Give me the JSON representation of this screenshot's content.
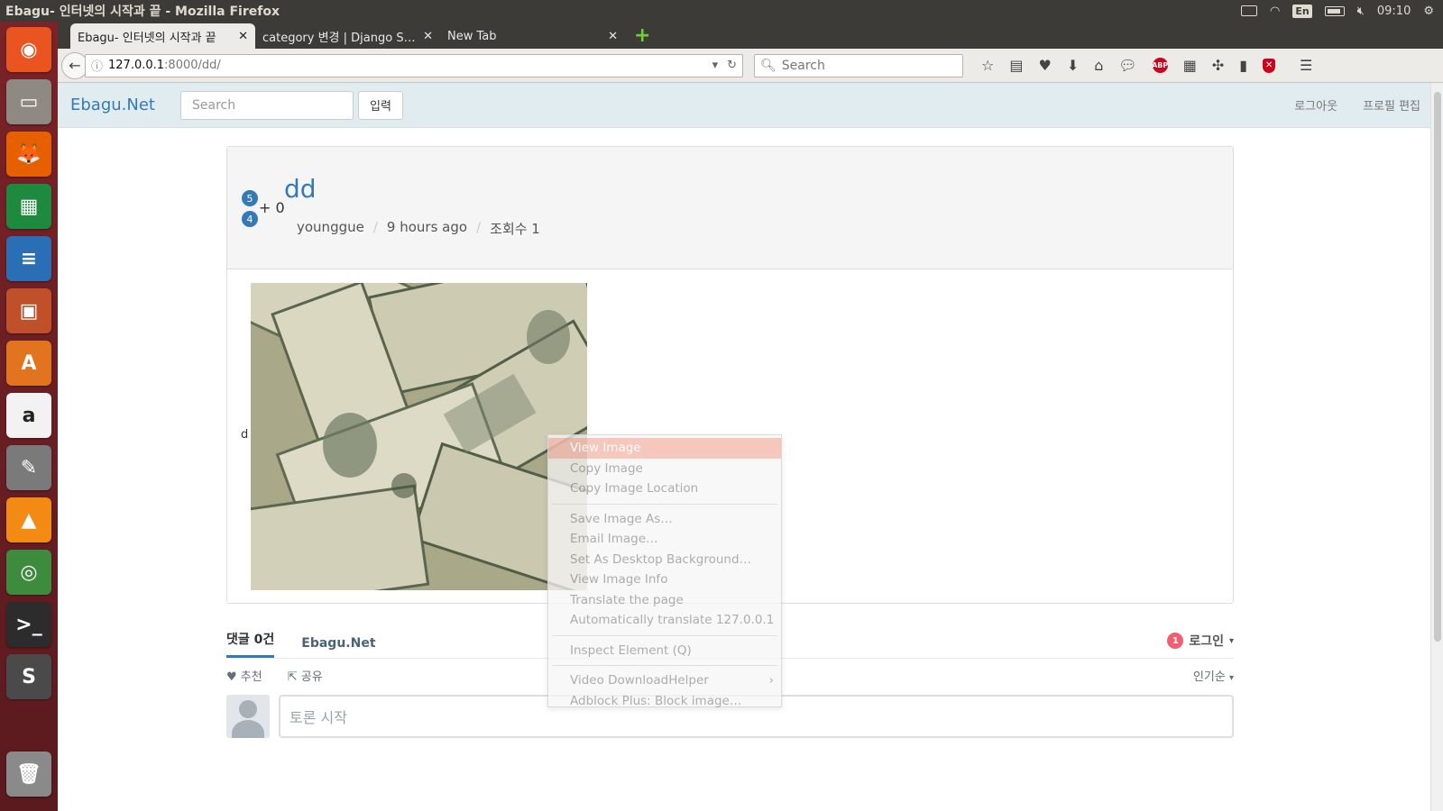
{
  "desktop": {
    "window_title": "Ebagu- 인터넷의 시작과 끝 - Mozilla Firefox",
    "indicators": {
      "lang": "En",
      "clock": "09:10"
    },
    "launcher": [
      {
        "name": "ubuntu-dash-icon",
        "color": "#e95420",
        "glyph": "◉"
      },
      {
        "name": "files-icon",
        "color": "#8e8a82",
        "glyph": "▭"
      },
      {
        "name": "firefox-icon",
        "color": "#e66000",
        "glyph": "🦊"
      },
      {
        "name": "calc-icon",
        "color": "#1e8a3e",
        "glyph": "▦"
      },
      {
        "name": "writer-icon",
        "color": "#2a6fb5",
        "glyph": "≡"
      },
      {
        "name": "impress-icon",
        "color": "#c0502a",
        "glyph": "▣"
      },
      {
        "name": "software-center-icon",
        "color": "#e2731f",
        "glyph": "A"
      },
      {
        "name": "amazon-icon",
        "color": "#f2f2f2",
        "glyph": "a"
      },
      {
        "name": "settings-icon",
        "color": "#7a7a7a",
        "glyph": "✎"
      },
      {
        "name": "vlc-icon",
        "color": "#f28a14",
        "glyph": "▲"
      },
      {
        "name": "chrome-icon",
        "color": "#3d8c3d",
        "glyph": "◎"
      },
      {
        "name": "terminal-icon",
        "color": "#2c2c2c",
        "glyph": ">_"
      },
      {
        "name": "sublime-icon",
        "color": "#4a4a4a",
        "glyph": "S"
      }
    ]
  },
  "browser": {
    "tabs": [
      {
        "label": "Ebagu- 인터넷의 시작과 끝",
        "active": true
      },
      {
        "label": "category 변경 | Django S…",
        "active": false
      },
      {
        "label": "New Tab",
        "active": false
      }
    ],
    "url_host": "127.0.0.1",
    "url_path": ":8000/dd/",
    "search_placeholder": "Search"
  },
  "site": {
    "brand": "Ebagu.Net",
    "search_placeholder": "Search",
    "search_button": "입력",
    "nav_right": [
      "로그아웃",
      "프로필 편집"
    ]
  },
  "post": {
    "votes_up": "5",
    "votes_down": "4",
    "score": "+ 0",
    "title": "dd",
    "author": "younggue",
    "time": "9 hours ago",
    "views": "조회수 1",
    "body": "d"
  },
  "comments": {
    "tab_count": "댓글 0건",
    "tab_site": "Ebagu.Net",
    "login_badge": "1",
    "login_label": "로그인",
    "recommend": "추천",
    "share": "공유",
    "sort": "인기순",
    "input_placeholder": "토론 시작"
  },
  "context_menu": {
    "items": [
      {
        "label": "View Image",
        "highlighted": true
      },
      {
        "label": "Copy Image"
      },
      {
        "label": "Copy Image Location"
      },
      {
        "sep": true
      },
      {
        "label": "Save Image As…"
      },
      {
        "label": "Email Image…"
      },
      {
        "label": "Set As Desktop Background…"
      },
      {
        "label": "View Image Info"
      },
      {
        "label": "Translate the page"
      },
      {
        "label": "Automatically translate 127.0.0.1"
      },
      {
        "sep": true
      },
      {
        "label": "Inspect Element (Q)"
      },
      {
        "sep": true
      },
      {
        "label": "Video DownloadHelper",
        "submenu": true
      },
      {
        "label": "Adblock Plus: Block image…"
      }
    ]
  }
}
